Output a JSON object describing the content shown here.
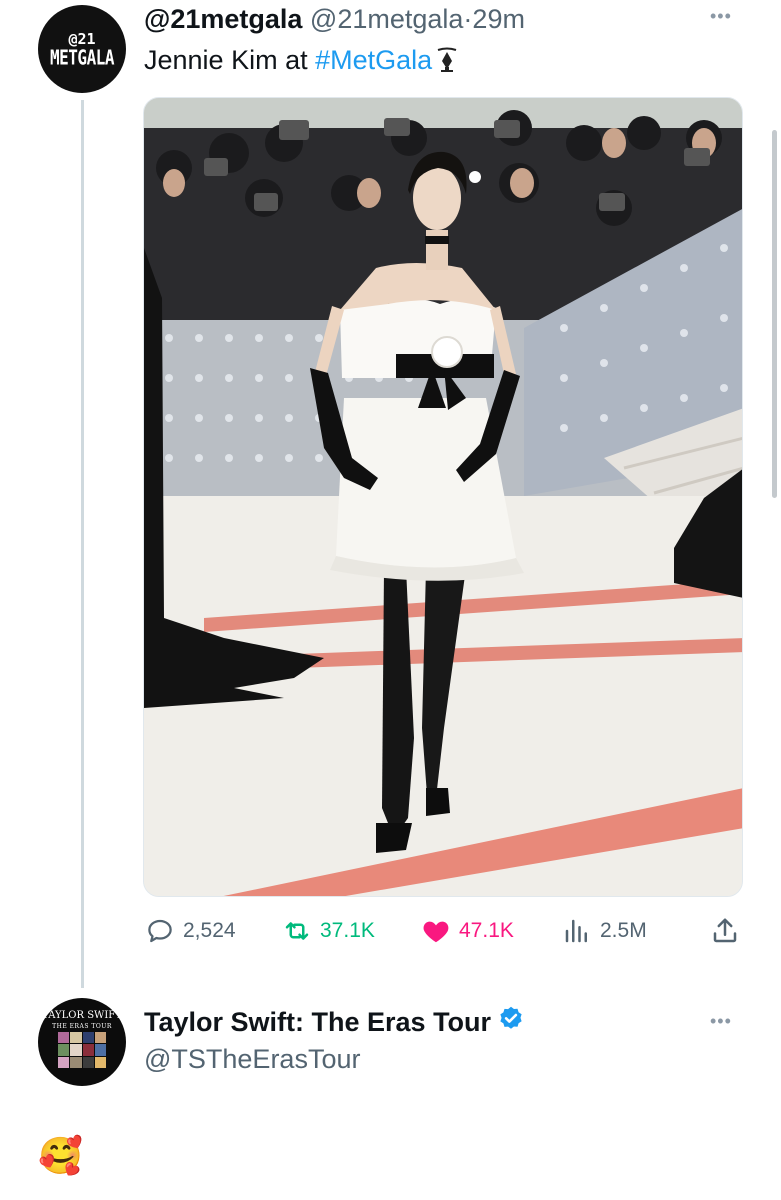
{
  "tweet1": {
    "avatar_text_top": "@21",
    "avatar_text_bottom": "METGALA",
    "display_name": "@21metgala",
    "handle": "@21metgala",
    "separator": "·",
    "time": "29m",
    "text_prefix": "Jennie Kim at ",
    "hashtag": "#MetGala",
    "media_alt": "photo",
    "metrics": {
      "replies": "2,524",
      "retweets": "37.1K",
      "likes": "47.1K",
      "views": "2.5M"
    }
  },
  "tweet2": {
    "avatar_title": "TAYLOR SWIFT",
    "avatar_subtitle": "THE ERAS TOUR",
    "display_name": "Taylor Swift: The Eras Tour",
    "handle": "@TSTheErasTour",
    "text": "🥰"
  },
  "icons": {
    "more": "more-dots-icon",
    "reply": "reply-bubble-icon",
    "retweet": "retweet-arrows-icon",
    "like": "heart-icon",
    "views": "analytics-bars-icon",
    "share": "share-upload-icon",
    "verified": "verified-badge-icon",
    "gala": "met-gala-emblem-icon"
  },
  "colors": {
    "text": "#0f1419",
    "secondary": "#536471",
    "link": "#1d9bf0",
    "retweet": "#00ba7c",
    "like": "#f91880",
    "verified": "#1d9bf0",
    "thread_line": "#cfd9de"
  }
}
